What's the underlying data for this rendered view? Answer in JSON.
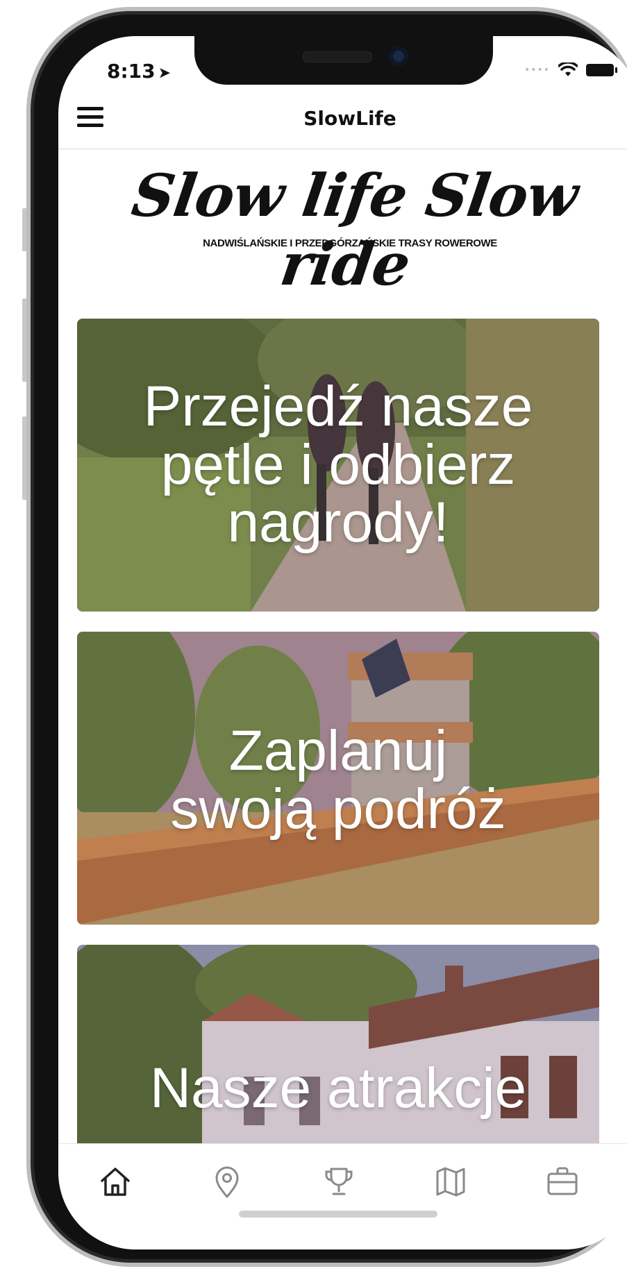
{
  "status_bar": {
    "time": "8:13",
    "location_icon": "location-arrow-icon"
  },
  "navbar": {
    "title": "SlowLife",
    "menu_icon": "hamburger-menu-icon"
  },
  "logo": {
    "script_text": "Slow life Slow ride",
    "subtitle": "NADWIŚLAŃSKIE I PRZEDGÓRZAŃSKIE TRASY ROWEROWE"
  },
  "cards": [
    {
      "lines": [
        "Przejedź nasze",
        "pętle i odbierz",
        "nagrody!"
      ]
    },
    {
      "lines": [
        "Zaplanuj",
        "swoją podróż"
      ]
    },
    {
      "lines": [
        "Nasze atrakcje"
      ]
    }
  ],
  "tabbar": {
    "items": [
      {
        "icon": "home-icon",
        "active": true
      },
      {
        "icon": "map-pin-icon",
        "active": false
      },
      {
        "icon": "trophy-icon",
        "active": false
      },
      {
        "icon": "map-icon",
        "active": false
      },
      {
        "icon": "briefcase-icon",
        "active": false
      }
    ]
  },
  "colors": {
    "text": "#111111",
    "tab_active": "#222222",
    "tab_inactive": "#8a8a8a"
  }
}
